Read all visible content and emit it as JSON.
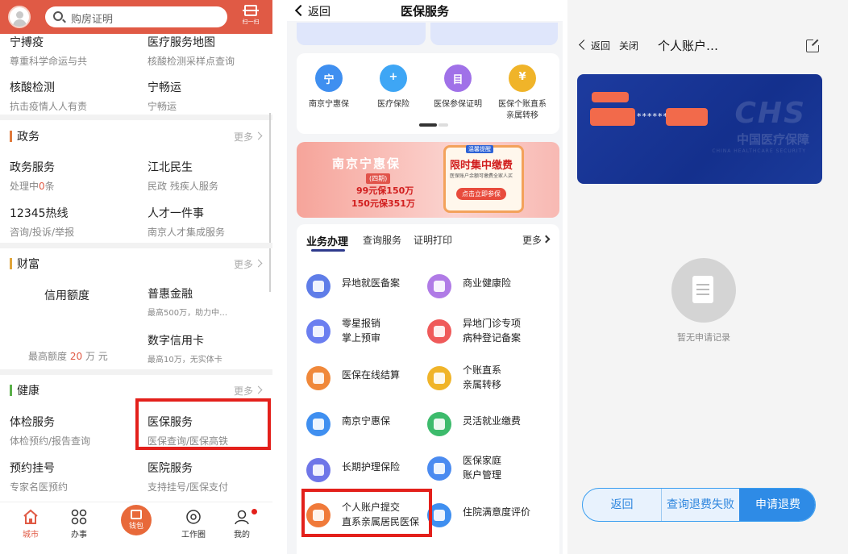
{
  "panel1": {
    "search_placeholder": "购房证明",
    "scan_label": "扫一扫",
    "top_items": [
      {
        "title": "宁搏疫",
        "sub": "尊重科学命运与共"
      },
      {
        "title": "医疗服务地图",
        "sub": "核酸检测采样点查询"
      },
      {
        "title": "核酸检测",
        "sub": "抗击疫情人人有责"
      },
      {
        "title": "宁畅运",
        "sub": "宁畅运"
      }
    ],
    "more_label": "更多",
    "sections": {
      "gov": {
        "name": "政务",
        "color": "#e07a3b",
        "items": [
          {
            "title": "政务服务",
            "sub_pre": "处理中",
            "sub_num": "0",
            "sub_post": "条"
          },
          {
            "title": "江北民生",
            "sub": "民政  残疾人服务"
          },
          {
            "title": "12345热线",
            "sub": "咨询/投诉/举报"
          },
          {
            "title": "人才一件事",
            "sub": "南京人才集成服务"
          }
        ]
      },
      "wealth": {
        "name": "财富",
        "color": "#e0a53b",
        "credit_title": "信用额度",
        "credit_sub_pre": "最高额度",
        "credit_num": "20",
        "credit_sub_post": "万 元",
        "items": [
          {
            "title": "普惠金融",
            "sub": "最高500万，助力中…"
          },
          {
            "title": "数字信用卡",
            "sub": "最高10万，无实体卡"
          }
        ]
      },
      "health": {
        "name": "健康",
        "color": "#5bb04a",
        "items": [
          {
            "title": "体检服务",
            "sub": "体检预约/报告查询"
          },
          {
            "title": "医保服务",
            "sub": "医保查询/医保高铁"
          },
          {
            "title": "预约挂号",
            "sub": "专家名医预约"
          },
          {
            "title": "医院服务",
            "sub": "支持挂号/医保支付"
          }
        ]
      }
    },
    "tabbar": [
      {
        "label": "城市",
        "icon": "home-icon"
      },
      {
        "label": "办事",
        "icon": "grid-icon"
      },
      {
        "label": "钱包",
        "icon": "wallet-icon"
      },
      {
        "label": "工作圈",
        "icon": "chat-icon"
      },
      {
        "label": "我的",
        "icon": "user-icon"
      }
    ]
  },
  "panel2": {
    "back_label": "返回",
    "title": "医保服务",
    "quick": [
      {
        "label": "南京宁惠保",
        "icon": "shield-icon",
        "glyph": "宁",
        "color": "#3f8ff0"
      },
      {
        "label": "医疗保险",
        "icon": "medical-cross-icon",
        "glyph": "+",
        "color": "#3ea6f5"
      },
      {
        "label": "医保参保证明",
        "icon": "certificate-icon",
        "glyph": "目",
        "color": "#a071e8"
      },
      {
        "label": "医保个账直系亲属转移",
        "icon": "coin-icon",
        "glyph": "¥",
        "color": "#f0b429"
      }
    ],
    "promo": {
      "title": "南京宁惠保",
      "subtitle": "(四期)",
      "line1": "99元保150万",
      "line2": "150元保351万",
      "tag": "温馨提醒",
      "board_title": "限时集中缴费",
      "board_desc": "医保账户余额可缴费全家人买",
      "button": "点击立即参保"
    },
    "tabs": [
      "业务办理",
      "查询服务",
      "证明打印"
    ],
    "more_label": "更多",
    "services": [
      {
        "label": "异地就医备案",
        "icon": "location-pin-icon",
        "color": "#5f7de8"
      },
      {
        "label": "商业健康险",
        "icon": "wallet-icon",
        "color": "#b07be6"
      },
      {
        "label": "零星报销\n掌上预审",
        "icon": "phone-icon",
        "color": "#6b7ef0"
      },
      {
        "label": "异地门诊专项\n病种登记备案",
        "icon": "map-pin-icon",
        "color": "#ef5a5a"
      },
      {
        "label": "医保在线结算",
        "icon": "yuan-box-icon",
        "color": "#f0883a"
      },
      {
        "label": "个账直系\n亲属转移",
        "icon": "coin-icon",
        "color": "#f0b429"
      },
      {
        "label": "南京宁惠保",
        "icon": "shield-icon",
        "color": "#3f8ff0"
      },
      {
        "label": "灵活就业缴费",
        "icon": "people-icon",
        "color": "#3dbb6c"
      },
      {
        "label": "长期护理保险",
        "icon": "wheelchair-icon",
        "color": "#6f76e8"
      },
      {
        "label": "医保家庭\n账户管理",
        "icon": "house-icon",
        "color": "#4b8bf0"
      },
      {
        "label": "个人账户提交\n直系亲属居民医保",
        "icon": "transfer-icon",
        "color": "#f07a3a"
      },
      {
        "label": "住院满意度评价",
        "icon": "rating-icon",
        "color": "#3f8ff0"
      }
    ]
  },
  "panel3": {
    "back_label": "返回",
    "close_label": "关闭",
    "title": "个人账户…",
    "card_number_mask": "******",
    "card_logo": "CHS",
    "card_logo_cn": "中国医疗保障",
    "card_logo_en": "CHINA HEALTHCARE SECURITY",
    "empty_text": "暂无申请记录",
    "buttons": [
      "返回",
      "查询退费失败",
      "申请退费"
    ]
  }
}
